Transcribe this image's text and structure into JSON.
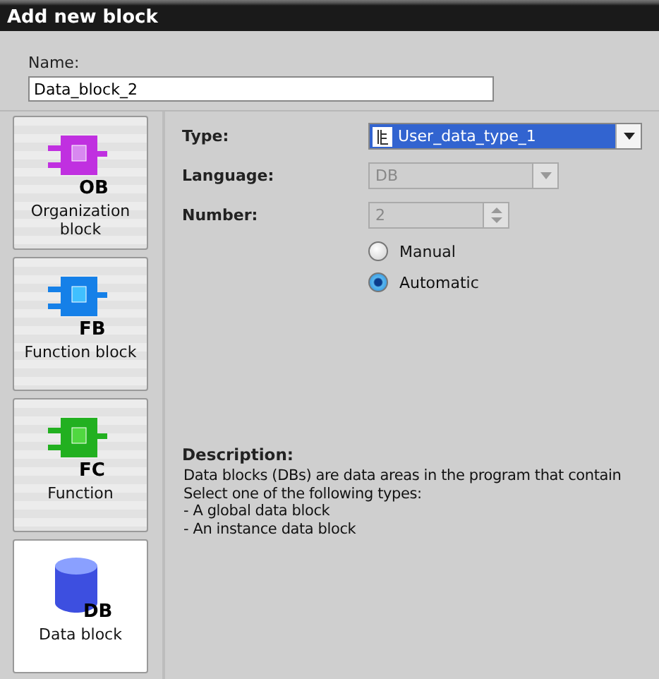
{
  "window": {
    "title": "Add new block"
  },
  "name_field": {
    "label": "Name:",
    "value": "Data_block_2"
  },
  "blocks": [
    {
      "kind": "ob",
      "badge": "OB",
      "label": "Organization block",
      "selected": false
    },
    {
      "kind": "fb",
      "badge": "FB",
      "label": "Function block",
      "selected": false
    },
    {
      "kind": "fc",
      "badge": "FC",
      "label": "Function",
      "selected": false
    },
    {
      "kind": "db",
      "badge": "DB",
      "label": "Data block",
      "selected": true
    }
  ],
  "type_field": {
    "label": "Type:",
    "value": "User_data_type_1"
  },
  "language_field": {
    "label": "Language:",
    "value": "DB",
    "disabled": true
  },
  "number_field": {
    "label": "Number:",
    "value": "2",
    "disabled": true
  },
  "number_mode": [
    {
      "label": "Manual",
      "selected": false
    },
    {
      "label": "Automatic",
      "selected": true
    }
  ],
  "description": {
    "title": "Description:",
    "lines": [
      "Data blocks (DBs) are data areas in the program that contain",
      "Select one of the following types:",
      "- A global data block",
      "- An instance data block"
    ]
  }
}
